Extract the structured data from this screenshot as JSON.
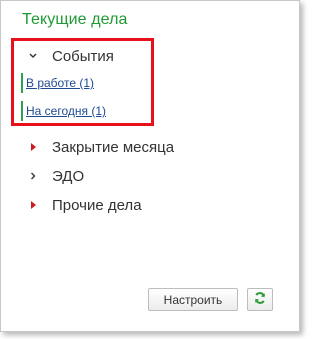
{
  "panel": {
    "title": "Текущие дела",
    "groups": [
      {
        "label": "События",
        "expanded": true,
        "items": [
          {
            "label": "В работе (1)"
          },
          {
            "label": "На сегодня (1)"
          }
        ]
      },
      {
        "label": "Закрытие месяца",
        "expanded": false,
        "marker": "red-triangle"
      },
      {
        "label": "ЭДО",
        "expanded": false,
        "marker": "chevron"
      },
      {
        "label": "Прочие дела",
        "expanded": false,
        "marker": "red-triangle"
      }
    ],
    "buttons": {
      "settings_label": "Настроить",
      "refresh_icon": "refresh-icon"
    }
  },
  "colors": {
    "title_green": "#1f9a34",
    "link_blue": "#1e4a93",
    "highlight_red": "#e8101b",
    "marker_red": "#d11b1b",
    "refresh_green": "#2e9a3a"
  }
}
